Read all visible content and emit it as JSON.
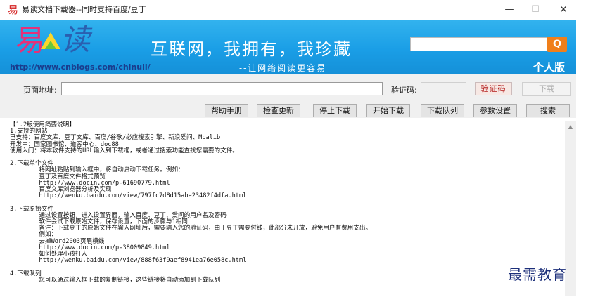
{
  "window": {
    "title": "易读文档下载器--同时支持百度/豆丁",
    "app_icon": "易",
    "minimize_icon": "—",
    "maximize_icon": "☐",
    "close_icon": "✕"
  },
  "banner": {
    "logo_yi": "易",
    "logo_du": "读",
    "url": "http://www.cnblogs.com/chinull/",
    "slogan": "互联网，我拥有，我珍藏",
    "sub_slogan": "--让网络阅读更容易",
    "search_value": "",
    "search_icon": "Q",
    "edition": "个人版"
  },
  "form": {
    "url_label": "页面地址:",
    "url_value": "",
    "captcha_label": "验证码:",
    "captcha_value": "",
    "captcha_image": "验证码",
    "download_label": "下载"
  },
  "toolbar_buttons": [
    "帮助手册",
    "检查更新",
    "停止下载",
    "开始下载",
    "下载队列",
    "参数设置",
    "搜索"
  ],
  "help_text": "【1.2版使用简要说明】\n1.支持的网站\n已支持：百度文库、豆丁文库、百度/谷歌/必应搜索引擎、新浪爱问、Mbalib\n开发中：国家图书馆、道客中心、doc88\n使用入门：将本软件支持的URL输入到下载框，或者通过搜索功能查找您需要的文件。\n\n2.下载单个文件\n        将网址粘贴到输入框中，将自动启动下载任务。例如：\n        豆丁及百度文件格式预览\n        http://www.docin.com/p-61690779.html\n        百度文库浏览器分析及实现\n        http://wenku.baidu.com/view/797fc7d8d15abe23482f4dfa.html\n\n3.下载原始文件\n        通过设置按钮，进入设置界面，输入百度、豆丁、爱问的用户名及密码\n        软件会试下载原始文件，保存设置，下面的步骤与1相同\n        备注：下载豆丁的原始文件在输入网址后，需要输入您的验证码，由于豆丁需要付钱，此部分未开放，避免用户有费用支出。\n        例如：\n        去掉Word2003页眉横线\n        http://www.docin.com/p-38009849.html\n        如何处理小孩打人\n        http://wenku.baidu.com/view/888f63f9aef8941ea76e058c.html\n\n4.下载队列\n        您可以通过输入框下载的复制链接，这些链接将自动添加到下载队列",
  "scroll_up_icon": "▲",
  "watermark": "最需教育"
}
